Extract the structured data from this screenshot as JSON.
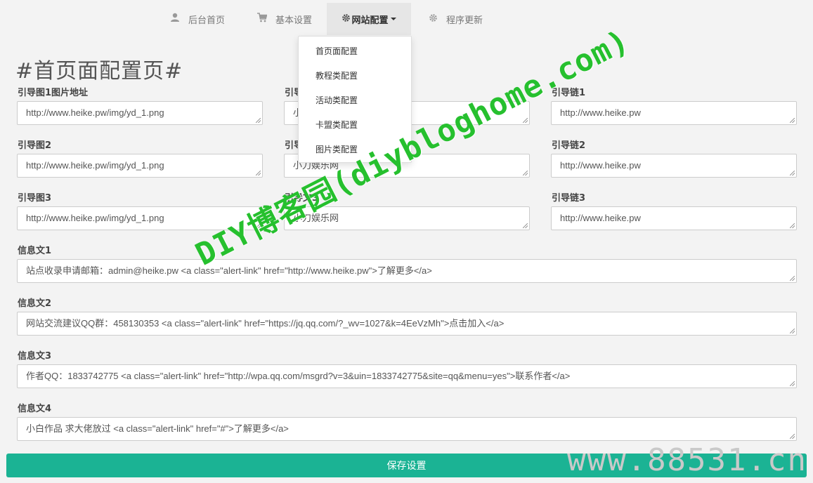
{
  "nav": {
    "home": "后台首页",
    "basic": "基本设置",
    "site": "网站配置",
    "update": "程序更新"
  },
  "dropdown": [
    "首页面配置",
    "教程类配置",
    "活动类配置",
    "卡盟类配置",
    "图片类配置"
  ],
  "page_title": "#首页面配置页#",
  "fields": {
    "img1_label": "引导图1图片地址",
    "img1_value": "http://www.heike.pw/img/yd_1.png",
    "text1_label": "引导文1",
    "text1_value": "小刀娱乐网",
    "link1_label": "引导链1",
    "link1_value": "http://www.heike.pw",
    "img2_label": "引导图2",
    "img2_value": "http://www.heike.pw/img/yd_1.png",
    "text2_label": "引导文2",
    "text2_value": "小刀娱乐网",
    "link2_label": "引导链2",
    "link2_value": "http://www.heike.pw",
    "img3_label": "引导图3",
    "img3_value": "http://www.heike.pw/img/yd_1.png",
    "text3_label": "引导文3",
    "text3_value": "小刀娱乐网",
    "link3_label": "引导链3",
    "link3_value": "http://www.heike.pw",
    "info1_label": "信息文1",
    "info1_value": "站点收录申请邮箱：admin@heike.pw <a class=\"alert-link\" href=\"http://www.heike.pw\">了解更多</a>",
    "info2_label": "信息文2",
    "info2_value": "网站交流建议QQ群：458130353 <a class=\"alert-link\" href=\"https://jq.qq.com/?_wv=1027&k=4EeVzMh\">点击加入</a>",
    "info3_label": "信息文3",
    "info3_value": "作者QQ：1833742775 <a class=\"alert-link\" href=\"http://wpa.qq.com/msgrd?v=3&uin=1833742775&site=qq&menu=yes\">联系作者</a>",
    "info4_label": "信息文4",
    "info4_value": "小白作品 求大佬放过 <a class=\"alert-link\" href=\"#\">了解更多</a>"
  },
  "save_label": "保存设置",
  "watermark": {
    "green": "DIY博客园(diybloghome.com)",
    "gray": "www.88531.cn"
  }
}
